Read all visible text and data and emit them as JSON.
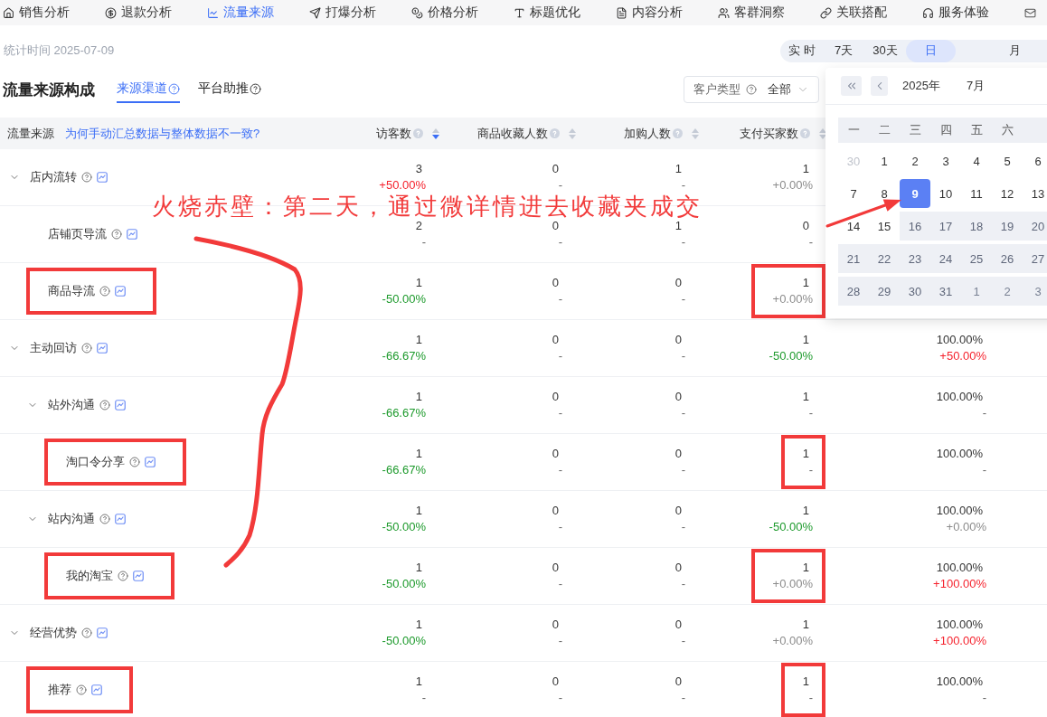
{
  "nav_tabs": [
    {
      "label": "销售分析",
      "selected": false
    },
    {
      "label": "退款分析",
      "selected": false
    },
    {
      "label": "流量来源",
      "selected": true
    },
    {
      "label": "打爆分析",
      "selected": false
    },
    {
      "label": "价格分析",
      "selected": false
    },
    {
      "label": "标题优化",
      "selected": false
    },
    {
      "label": "内容分析",
      "selected": false
    },
    {
      "label": "客群洞察",
      "selected": false
    },
    {
      "label": "关联搭配",
      "selected": false
    },
    {
      "label": "服务体验",
      "selected": false
    }
  ],
  "stat_time": "统计时间 2025-07-09",
  "date_ranges": [
    {
      "label": "实 时",
      "selected": false
    },
    {
      "label": "7天",
      "selected": false
    },
    {
      "label": "30天",
      "selected": false
    },
    {
      "label": "日",
      "selected": true
    },
    {
      "label": "月",
      "selected": false
    }
  ],
  "section": {
    "title": "流量来源构成",
    "tabs": [
      {
        "label": "来源渠道",
        "selected": true
      },
      {
        "label": "平台助推",
        "selected": false
      }
    ],
    "filter": {
      "label": "客户类型",
      "value": "全部"
    }
  },
  "calendar": {
    "year": "2025年",
    "month": "7月",
    "weekdays": [
      "一",
      "二",
      "三",
      "四",
      "五",
      "六"
    ],
    "days": [
      {
        "label": "30",
        "outside": true,
        "disabled": false,
        "selected": false
      },
      {
        "label": "1",
        "outside": false,
        "disabled": false,
        "selected": false
      },
      {
        "label": "2",
        "outside": false,
        "disabled": false,
        "selected": false
      },
      {
        "label": "3",
        "outside": false,
        "disabled": false,
        "selected": false
      },
      {
        "label": "4",
        "outside": false,
        "disabled": false,
        "selected": false
      },
      {
        "label": "5",
        "outside": false,
        "disabled": false,
        "selected": false
      },
      {
        "label": "6",
        "outside": false,
        "disabled": false,
        "selected": false
      },
      {
        "label": "7",
        "outside": false,
        "disabled": false,
        "selected": false
      },
      {
        "label": "8",
        "outside": false,
        "disabled": false,
        "selected": false
      },
      {
        "label": "9",
        "outside": false,
        "disabled": false,
        "selected": true
      },
      {
        "label": "10",
        "outside": false,
        "disabled": false,
        "selected": false
      },
      {
        "label": "11",
        "outside": false,
        "disabled": false,
        "selected": false
      },
      {
        "label": "12",
        "outside": false,
        "disabled": false,
        "selected": false
      },
      {
        "label": "13",
        "outside": false,
        "disabled": false,
        "selected": false
      },
      {
        "label": "14",
        "outside": false,
        "disabled": false,
        "selected": false
      },
      {
        "label": "15",
        "outside": false,
        "disabled": false,
        "selected": false
      },
      {
        "label": "16",
        "outside": false,
        "disabled": true,
        "selected": false
      },
      {
        "label": "17",
        "outside": false,
        "disabled": true,
        "selected": false
      },
      {
        "label": "18",
        "outside": false,
        "disabled": true,
        "selected": false
      },
      {
        "label": "19",
        "outside": false,
        "disabled": true,
        "selected": false
      },
      {
        "label": "20",
        "outside": false,
        "disabled": true,
        "selected": false
      },
      {
        "label": "21",
        "outside": false,
        "disabled": true,
        "selected": false
      },
      {
        "label": "22",
        "outside": false,
        "disabled": true,
        "selected": false
      },
      {
        "label": "23",
        "outside": false,
        "disabled": true,
        "selected": false
      },
      {
        "label": "24",
        "outside": false,
        "disabled": true,
        "selected": false
      },
      {
        "label": "25",
        "outside": false,
        "disabled": true,
        "selected": false
      },
      {
        "label": "26",
        "outside": false,
        "disabled": true,
        "selected": false
      },
      {
        "label": "27",
        "outside": false,
        "disabled": true,
        "selected": false
      },
      {
        "label": "28",
        "outside": false,
        "disabled": true,
        "selected": false
      },
      {
        "label": "29",
        "outside": false,
        "disabled": true,
        "selected": false
      },
      {
        "label": "30",
        "outside": false,
        "disabled": true,
        "selected": false
      },
      {
        "label": "31",
        "outside": false,
        "disabled": true,
        "selected": false
      },
      {
        "label": "1",
        "outside": true,
        "disabled": true,
        "selected": false
      },
      {
        "label": "2",
        "outside": true,
        "disabled": true,
        "selected": false
      },
      {
        "label": "3",
        "outside": true,
        "disabled": true,
        "selected": false
      }
    ]
  },
  "table": {
    "source_header": {
      "label": "流量来源",
      "link": "为何手动汇总数据与整体数据不一致?"
    },
    "columns": [
      {
        "label": "访客数",
        "sorted": true
      },
      {
        "label": "商品收藏人数",
        "sorted": false
      },
      {
        "label": "加购人数",
        "sorted": false
      },
      {
        "label": "支付买家数",
        "sorted": false
      }
    ],
    "rows": [
      {
        "name": "店内流转",
        "expanded": true,
        "marked": false,
        "cells": [
          {
            "value": "3",
            "change": "+50.00%",
            "kind": "up"
          },
          {
            "value": "0",
            "change": "-",
            "kind": "none"
          },
          {
            "value": "1",
            "change": "-",
            "kind": "none"
          },
          {
            "value": "1",
            "change": "+0.00%",
            "kind": "flat"
          }
        ],
        "children": [
          {
            "name": "店铺页导流",
            "marked": false,
            "cells": [
              {
                "value": "2",
                "change": "-",
                "kind": "none"
              },
              {
                "value": "0",
                "change": "-",
                "kind": "none"
              },
              {
                "value": "1",
                "change": "-",
                "kind": "none"
              },
              {
                "value": "0",
                "change": "-",
                "kind": "none"
              }
            ]
          },
          {
            "name": "商品导流",
            "marked": true,
            "cells": [
              {
                "value": "1",
                "change": "-50.00%",
                "kind": "down"
              },
              {
                "value": "0",
                "change": "-",
                "kind": "none"
              },
              {
                "value": "0",
                "change": "-",
                "kind": "none"
              },
              {
                "value": "1",
                "change": "+0.00%",
                "kind": "flat"
              }
            ]
          }
        ]
      },
      {
        "name": "主动回访",
        "expanded": true,
        "marked": false,
        "cells": [
          {
            "value": "1",
            "change": "-66.67%",
            "kind": "down"
          },
          {
            "value": "0",
            "change": "-",
            "kind": "none"
          },
          {
            "value": "0",
            "change": "-",
            "kind": "none"
          },
          {
            "value": "1",
            "change": "-50.00%",
            "kind": "down"
          },
          {
            "value": "100.00%",
            "change": "+50.00%",
            "kind": "up"
          }
        ],
        "children": [
          {
            "name": "站外沟通",
            "expanded": true,
            "marked": false,
            "cells": [
              {
                "value": "1",
                "change": "-66.67%",
                "kind": "down"
              },
              {
                "value": "0",
                "change": "-",
                "kind": "none"
              },
              {
                "value": "0",
                "change": "-",
                "kind": "none"
              },
              {
                "value": "1",
                "change": "-",
                "kind": "none"
              },
              {
                "value": "100.00%",
                "change": "-",
                "kind": "none"
              }
            ],
            "children": [
              {
                "name": "淘口令分享",
                "marked": true,
                "cells": [
                  {
                    "value": "1",
                    "change": "-66.67%",
                    "kind": "down"
                  },
                  {
                    "value": "0",
                    "change": "-",
                    "kind": "none"
                  },
                  {
                    "value": "0",
                    "change": "-",
                    "kind": "none"
                  },
                  {
                    "value": "1",
                    "change": "-",
                    "kind": "none"
                  },
                  {
                    "value": "100.00%",
                    "change": "-",
                    "kind": "none"
                  }
                ]
              }
            ]
          },
          {
            "name": "站内沟通",
            "expanded": true,
            "marked": false,
            "cells": [
              {
                "value": "1",
                "change": "-50.00%",
                "kind": "down"
              },
              {
                "value": "0",
                "change": "-",
                "kind": "none"
              },
              {
                "value": "0",
                "change": "-",
                "kind": "none"
              },
              {
                "value": "1",
                "change": "-50.00%",
                "kind": "down"
              },
              {
                "value": "100.00%",
                "change": "+0.00%",
                "kind": "flat"
              }
            ],
            "children": [
              {
                "name": "我的淘宝",
                "marked": true,
                "cells": [
                  {
                    "value": "1",
                    "change": "-50.00%",
                    "kind": "down"
                  },
                  {
                    "value": "0",
                    "change": "-",
                    "kind": "none"
                  },
                  {
                    "value": "0",
                    "change": "-",
                    "kind": "none"
                  },
                  {
                    "value": "1",
                    "change": "+0.00%",
                    "kind": "flat"
                  },
                  {
                    "value": "100.00%",
                    "change": "+100.00%",
                    "kind": "up"
                  }
                ]
              }
            ]
          }
        ]
      },
      {
        "name": "经营优势",
        "expanded": true,
        "marked": false,
        "cells": [
          {
            "value": "1",
            "change": "-50.00%",
            "kind": "down"
          },
          {
            "value": "0",
            "change": "-",
            "kind": "none"
          },
          {
            "value": "0",
            "change": "-",
            "kind": "none"
          },
          {
            "value": "1",
            "change": "+0.00%",
            "kind": "flat"
          },
          {
            "value": "100.00%",
            "change": "+100.00%",
            "kind": "up"
          }
        ],
        "children": [
          {
            "name": "推荐",
            "marked": true,
            "cells": [
              {
                "value": "1",
                "change": "-",
                "kind": "none"
              },
              {
                "value": "0",
                "change": "-",
                "kind": "none"
              },
              {
                "value": "0",
                "change": "-",
                "kind": "none"
              },
              {
                "value": "1",
                "change": "-",
                "kind": "none"
              },
              {
                "value": "100.00%",
                "change": "-",
                "kind": "none"
              }
            ]
          }
        ]
      }
    ]
  },
  "annotation": {
    "text": "火烧赤壁：第二天，通过微详情进去收藏夹成交"
  }
}
